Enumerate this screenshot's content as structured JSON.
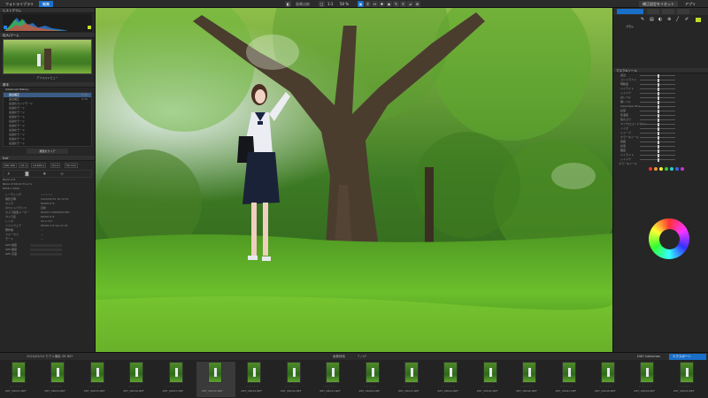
{
  "topbar": {
    "tabs": [
      "フォトライブラリ",
      "編集"
    ],
    "view_label": "画像比較",
    "zoom": "1:1",
    "zoom_pct": "50 %",
    "right_buttons": [
      "補正設定をリセット",
      "アプリ",
      "パネル"
    ]
  },
  "left": {
    "histogram_title": "ヒストグラム",
    "navigator_title": "拡大/ズーム",
    "navigator_caption": "デフォルトビュー",
    "basic_title": "基本",
    "advanced_title": "Advanced History",
    "history_rows": [
      "露出補正",
      "露出補正",
      "最適化ガイドモード",
      "最適化モード",
      "最適化モード",
      "最適化モード",
      "最適化モード",
      "最適化モード",
      "最適化モード",
      "最適化モード",
      "最適化モード",
      "最適化モード"
    ],
    "history_vals": [
      "0.25",
      "0.35"
    ],
    "apply_button": "履歴をクリア",
    "exif_title": "Exif",
    "exif_buttons": [
      "ISO 100",
      "1/1 s",
      "1/1600 s",
      "f/1.4",
      "50 mm"
    ],
    "camera": "Nikon Z 8",
    "lens": "Nikon Z 50mm f/1.2 S",
    "size": "8256 x 5504",
    "meta_rows": [
      {
        "k": "レーティング",
        "v": "☆☆☆☆☆"
      },
      {
        "k": "撮影日時",
        "v": "2024/05/24 16:10:51"
      },
      {
        "k": "カメラ",
        "v": "NIKON Z 8"
      },
      {
        "k": "ホワイトバランス",
        "v": "自動"
      },
      {
        "k": "カメラ製造メーカー",
        "v": "NIKON CORPORATION"
      },
      {
        "k": "カメラ名",
        "v": "NIKON Z 8"
      },
      {
        "k": "レンズ",
        "v": "50.0 mm"
      },
      {
        "k": "ソフトウェア",
        "v": "NIKON Z 8 Ver.02.00"
      },
      {
        "k": "著作権",
        "v": "—"
      },
      {
        "k": "フォーカス",
        "v": "—"
      },
      {
        "k": "モード",
        "v": "—"
      }
    ],
    "gps_rows": [
      "GPS 緯度",
      "GPS 経度",
      "GPS 高度"
    ]
  },
  "right": {
    "panel_title": "ローカル補正",
    "brush_label": "ブラシ",
    "section1": "マスク&ツール",
    "rows": [
      "露出",
      "コントラスト",
      "明瞭度",
      "ハイライト",
      "シャドウ",
      "白レベル",
      "黒レベル",
      "ClearView Plus",
      "彩度",
      "色温度",
      "色かぶり",
      "マイクロコントラスト",
      "ノイズ",
      "シャープ",
      "カラーホイール",
      "色相",
      "彩度",
      "輝度",
      "ハイライト",
      "シャドウ"
    ],
    "wheel_label": "カラーホイール"
  },
  "filmbar": {
    "path": "2024/05/24 モデル撮影 Z8 NEF",
    "center_label": "画像検索",
    "count": "7 / 47",
    "right_tabs": [
      "DXO Collection",
      "エクスポート"
    ]
  },
  "filmstrip": {
    "names": [
      "Z8T_08033.NEF",
      "Z8T_08034.NEF",
      "Z8T_08035.NEF",
      "Z8T_08036.NEF",
      "Z8T_08037.NEF",
      "Z8T_08038.NEF",
      "Z8T_08039.NEF",
      "Z8T_08040.NEF",
      "Z8T_08041.NEF",
      "Z8T_08042.NEF",
      "Z8T_08043.NEF",
      "Z8T_08044.NEF",
      "Z8T_08045.NEF",
      "Z8T_08046.NEF",
      "Z8T_08047.NEF",
      "Z8T_08048.NEF",
      "Z8T_08049.NEF",
      "Z8T_08050.NEF"
    ],
    "stars": "☆☆☆☆☆"
  },
  "colors": {
    "accent": "#1a6fc9",
    "bg": "#262626"
  }
}
